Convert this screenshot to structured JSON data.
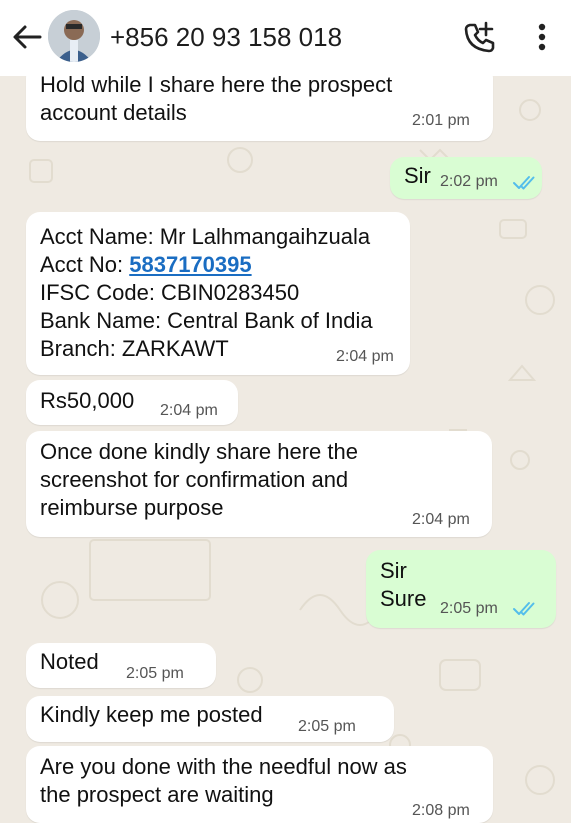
{
  "header": {
    "contact": "+856 20 93 158 018",
    "back_icon": "back-arrow-icon",
    "call_icon": "add-call-icon",
    "menu_icon": "more-vert-icon"
  },
  "colors": {
    "wallpaper": "#efeae2",
    "incoming_bubble": "#ffffff",
    "outgoing_bubble": "#d9fdd3",
    "read_ticks": "#53bdeb",
    "link": "#1a6dc2"
  },
  "messages": [
    {
      "dir": "in",
      "lines": [
        "Hold while I share here the prospect",
        "account details"
      ],
      "time": "2:01 pm"
    },
    {
      "dir": "out",
      "lines": [
        "Sir"
      ],
      "time": "2:02 pm",
      "status": "read"
    },
    {
      "dir": "in",
      "lines": [
        "Acct Name: Mr Lalhmangaihzuala",
        "Acct No: ",
        "IFSC Code: CBIN0283450",
        "Bank Name: Central Bank of India",
        "Branch: ZARKAWT"
      ],
      "acct_number": "5837170395",
      "time": "2:04 pm"
    },
    {
      "dir": "in",
      "lines": [
        "Rs50,000"
      ],
      "time": "2:04 pm"
    },
    {
      "dir": "in",
      "lines": [
        "Once done kindly share here the",
        "screenshot for confirmation and",
        "reimburse purpose"
      ],
      "time": "2:04 pm"
    },
    {
      "dir": "out",
      "lines": [
        "Sir",
        "Sure"
      ],
      "time": "2:05 pm",
      "status": "read"
    },
    {
      "dir": "in",
      "lines": [
        "Noted"
      ],
      "time": "2:05 pm"
    },
    {
      "dir": "in",
      "lines": [
        "Kindly keep me posted"
      ],
      "time": "2:05 pm"
    },
    {
      "dir": "in",
      "lines": [
        "Are you done with the needful now as",
        "the prospect are waiting"
      ],
      "time": "2:08 pm"
    }
  ]
}
